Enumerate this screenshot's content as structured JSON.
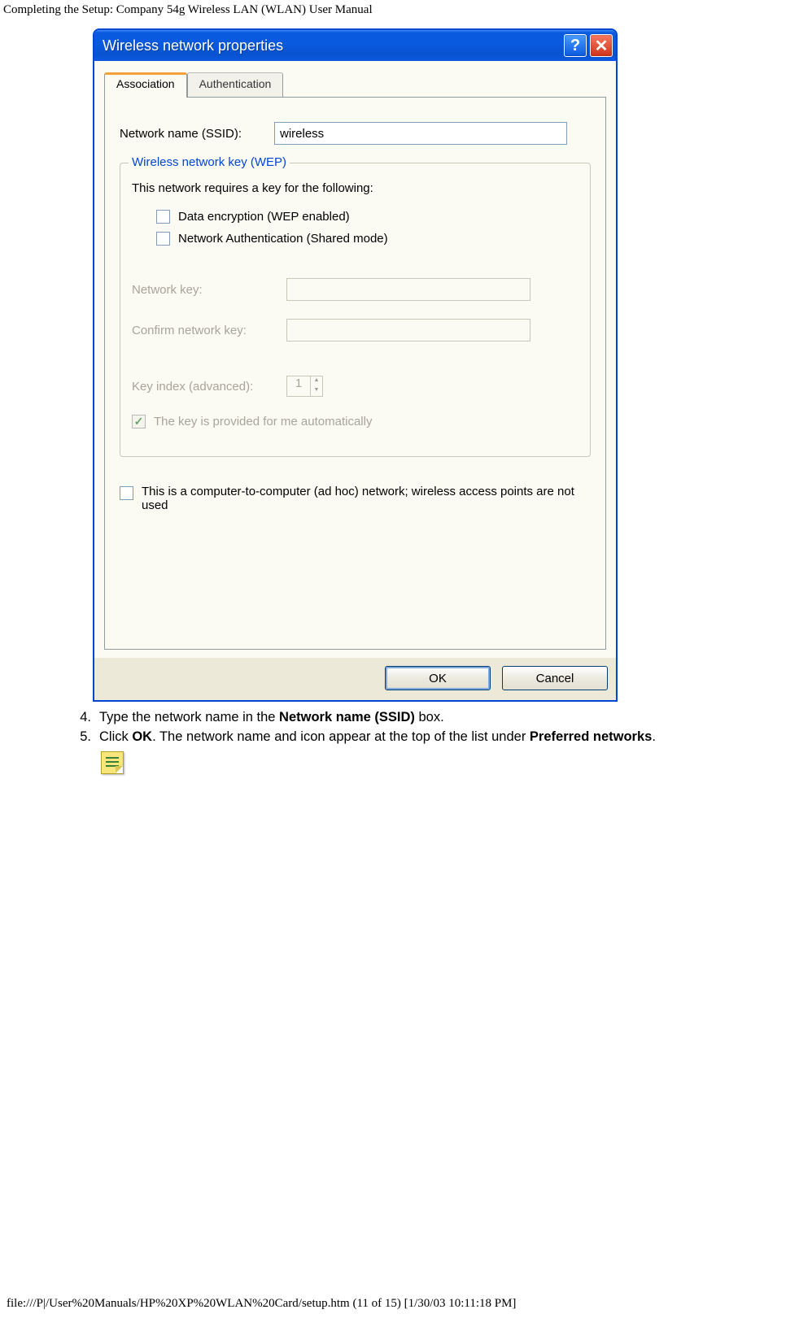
{
  "page_header": "Completing the Setup: Company 54g Wireless LAN (WLAN) User Manual",
  "dialog": {
    "title": "Wireless network properties",
    "tabs": [
      "Association",
      "Authentication"
    ],
    "active_tab": 0,
    "ssid_label": "Network name (SSID):",
    "ssid_value": "wireless",
    "group_legend": "Wireless network key (WEP)",
    "group_text": "This network requires a key for the following:",
    "cb_data_encryption": "Data encryption (WEP enabled)",
    "cb_net_auth": "Network Authentication (Shared mode)",
    "netkey_label": "Network key:",
    "confirm_label": "Confirm network key:",
    "keyindex_label": "Key index (advanced):",
    "keyindex_value": "1",
    "auto_key_label": "The key is provided for me automatically",
    "adhoc_label": "This is a computer-to-computer (ad hoc) network; wireless access points are not used",
    "ok_label": "OK",
    "cancel_label": "Cancel"
  },
  "steps": {
    "s4_num": "4.",
    "s4_a": "Type the network name in the ",
    "s4_b": "Network name (SSID)",
    "s4_c": " box.",
    "s5_num": "5.",
    "s5_a": "Click ",
    "s5_b": "OK",
    "s5_c": ". The network name and icon appear at the top of the list under ",
    "s5_d": "Preferred networks",
    "s5_e": "."
  },
  "footer": "file:///P|/User%20Manuals/HP%20XP%20WLAN%20Card/setup.htm (11 of 15) [1/30/03 10:11:18 PM]"
}
